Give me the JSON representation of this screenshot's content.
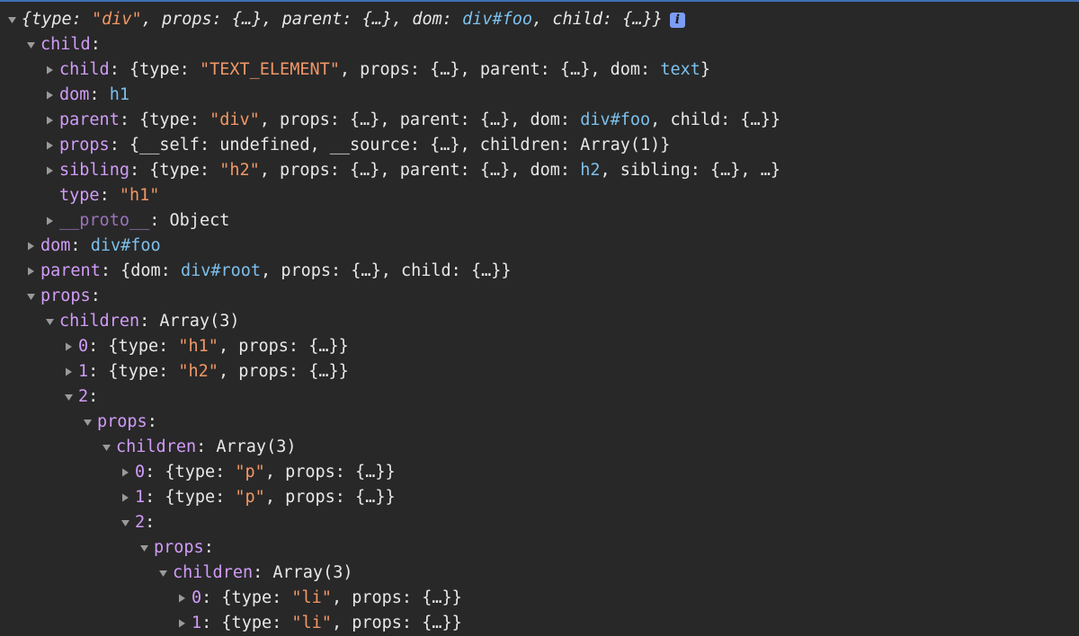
{
  "rows": [
    {
      "indent": 0,
      "toggle": "expanded",
      "italic": true,
      "info": true,
      "segments": [
        {
          "t": "{type: ",
          "c": "plain"
        },
        {
          "t": "\"div\"",
          "c": "str"
        },
        {
          "t": ", props: {…}, parent: {…}, dom: ",
          "c": "plain"
        },
        {
          "t": "div#foo",
          "c": "node"
        },
        {
          "t": ", child: {…}}",
          "c": "plain"
        }
      ]
    },
    {
      "indent": 1,
      "toggle": "expanded",
      "segments": [
        {
          "t": "child",
          "c": "key"
        },
        {
          "t": ":",
          "c": "plain"
        }
      ]
    },
    {
      "indent": 2,
      "toggle": "collapsed",
      "segments": [
        {
          "t": "child",
          "c": "key"
        },
        {
          "t": ": {type: ",
          "c": "plain"
        },
        {
          "t": "\"TEXT_ELEMENT\"",
          "c": "str"
        },
        {
          "t": ", props: {…}, parent: {…}, dom: ",
          "c": "plain"
        },
        {
          "t": "text",
          "c": "node"
        },
        {
          "t": "}",
          "c": "plain"
        }
      ]
    },
    {
      "indent": 2,
      "toggle": "collapsed",
      "segments": [
        {
          "t": "dom",
          "c": "key"
        },
        {
          "t": ": ",
          "c": "plain"
        },
        {
          "t": "h1",
          "c": "node"
        }
      ]
    },
    {
      "indent": 2,
      "toggle": "collapsed",
      "segments": [
        {
          "t": "parent",
          "c": "key"
        },
        {
          "t": ": {type: ",
          "c": "plain"
        },
        {
          "t": "\"div\"",
          "c": "str"
        },
        {
          "t": ", props: {…}, parent: {…}, dom: ",
          "c": "plain"
        },
        {
          "t": "div#foo",
          "c": "node"
        },
        {
          "t": ", child: {…}}",
          "c": "plain"
        }
      ]
    },
    {
      "indent": 2,
      "toggle": "collapsed",
      "segments": [
        {
          "t": "props",
          "c": "key"
        },
        {
          "t": ": {__self: undefined, __source: {…}, children: Array(1)}",
          "c": "plain"
        }
      ]
    },
    {
      "indent": 2,
      "toggle": "collapsed",
      "segments": [
        {
          "t": "sibling",
          "c": "key"
        },
        {
          "t": ": {type: ",
          "c": "plain"
        },
        {
          "t": "\"h2\"",
          "c": "str"
        },
        {
          "t": ", props: {…}, parent: {…}, dom: ",
          "c": "plain"
        },
        {
          "t": "h2",
          "c": "node"
        },
        {
          "t": ", sibling: {…}, …}",
          "c": "plain"
        }
      ]
    },
    {
      "indent": 2,
      "toggle": "none",
      "segments": [
        {
          "t": "type",
          "c": "key"
        },
        {
          "t": ": ",
          "c": "plain"
        },
        {
          "t": "\"h1\"",
          "c": "str"
        }
      ]
    },
    {
      "indent": 2,
      "toggle": "collapsed",
      "segments": [
        {
          "t": "__proto__",
          "c": "key-dim"
        },
        {
          "t": ": Object",
          "c": "plain"
        }
      ]
    },
    {
      "indent": 1,
      "toggle": "collapsed",
      "segments": [
        {
          "t": "dom",
          "c": "key"
        },
        {
          "t": ": ",
          "c": "plain"
        },
        {
          "t": "div#foo",
          "c": "node"
        }
      ]
    },
    {
      "indent": 1,
      "toggle": "collapsed",
      "segments": [
        {
          "t": "parent",
          "c": "key"
        },
        {
          "t": ": {dom: ",
          "c": "plain"
        },
        {
          "t": "div#root",
          "c": "node"
        },
        {
          "t": ", props: {…}, child: {…}}",
          "c": "plain"
        }
      ]
    },
    {
      "indent": 1,
      "toggle": "expanded",
      "segments": [
        {
          "t": "props",
          "c": "key"
        },
        {
          "t": ":",
          "c": "plain"
        }
      ]
    },
    {
      "indent": 2,
      "toggle": "expanded",
      "segments": [
        {
          "t": "children",
          "c": "key"
        },
        {
          "t": ": Array(3)",
          "c": "plain"
        }
      ]
    },
    {
      "indent": 3,
      "toggle": "collapsed",
      "segments": [
        {
          "t": "0",
          "c": "key"
        },
        {
          "t": ": {type: ",
          "c": "plain"
        },
        {
          "t": "\"h1\"",
          "c": "str"
        },
        {
          "t": ", props: {…}}",
          "c": "plain"
        }
      ]
    },
    {
      "indent": 3,
      "toggle": "collapsed",
      "segments": [
        {
          "t": "1",
          "c": "key"
        },
        {
          "t": ": {type: ",
          "c": "plain"
        },
        {
          "t": "\"h2\"",
          "c": "str"
        },
        {
          "t": ", props: {…}}",
          "c": "plain"
        }
      ]
    },
    {
      "indent": 3,
      "toggle": "expanded",
      "segments": [
        {
          "t": "2",
          "c": "key"
        },
        {
          "t": ":",
          "c": "plain"
        }
      ]
    },
    {
      "indent": 4,
      "toggle": "expanded",
      "segments": [
        {
          "t": "props",
          "c": "key"
        },
        {
          "t": ":",
          "c": "plain"
        }
      ]
    },
    {
      "indent": 5,
      "toggle": "expanded",
      "segments": [
        {
          "t": "children",
          "c": "key"
        },
        {
          "t": ": Array(3)",
          "c": "plain"
        }
      ]
    },
    {
      "indent": 6,
      "toggle": "collapsed",
      "segments": [
        {
          "t": "0",
          "c": "key"
        },
        {
          "t": ": {type: ",
          "c": "plain"
        },
        {
          "t": "\"p\"",
          "c": "str"
        },
        {
          "t": ", props: {…}}",
          "c": "plain"
        }
      ]
    },
    {
      "indent": 6,
      "toggle": "collapsed",
      "segments": [
        {
          "t": "1",
          "c": "key"
        },
        {
          "t": ": {type: ",
          "c": "plain"
        },
        {
          "t": "\"p\"",
          "c": "str"
        },
        {
          "t": ", props: {…}}",
          "c": "plain"
        }
      ]
    },
    {
      "indent": 6,
      "toggle": "expanded",
      "segments": [
        {
          "t": "2",
          "c": "key"
        },
        {
          "t": ":",
          "c": "plain"
        }
      ]
    },
    {
      "indent": 7,
      "toggle": "expanded",
      "segments": [
        {
          "t": "props",
          "c": "key"
        },
        {
          "t": ":",
          "c": "plain"
        }
      ]
    },
    {
      "indent": 8,
      "toggle": "expanded",
      "segments": [
        {
          "t": "children",
          "c": "key"
        },
        {
          "t": ": Array(3)",
          "c": "plain"
        }
      ]
    },
    {
      "indent": 9,
      "toggle": "collapsed",
      "segments": [
        {
          "t": "0",
          "c": "key"
        },
        {
          "t": ": {type: ",
          "c": "plain"
        },
        {
          "t": "\"li\"",
          "c": "str"
        },
        {
          "t": ", props: {…}}",
          "c": "plain"
        }
      ]
    },
    {
      "indent": 9,
      "toggle": "collapsed",
      "segments": [
        {
          "t": "1",
          "c": "key"
        },
        {
          "t": ": {type: ",
          "c": "plain"
        },
        {
          "t": "\"li\"",
          "c": "str"
        },
        {
          "t": ", props: {…}}",
          "c": "plain"
        }
      ]
    }
  ],
  "info_badge": "i",
  "icons": {
    "expanded": "triangle-down-icon",
    "collapsed": "triangle-right-icon"
  },
  "colors": {
    "background": "#282828",
    "key": "#d19cf8",
    "string": "#f29766",
    "dom_node": "#7cc0ec",
    "text": "#e8e8e8",
    "info_badge": "#7c9cf5"
  }
}
